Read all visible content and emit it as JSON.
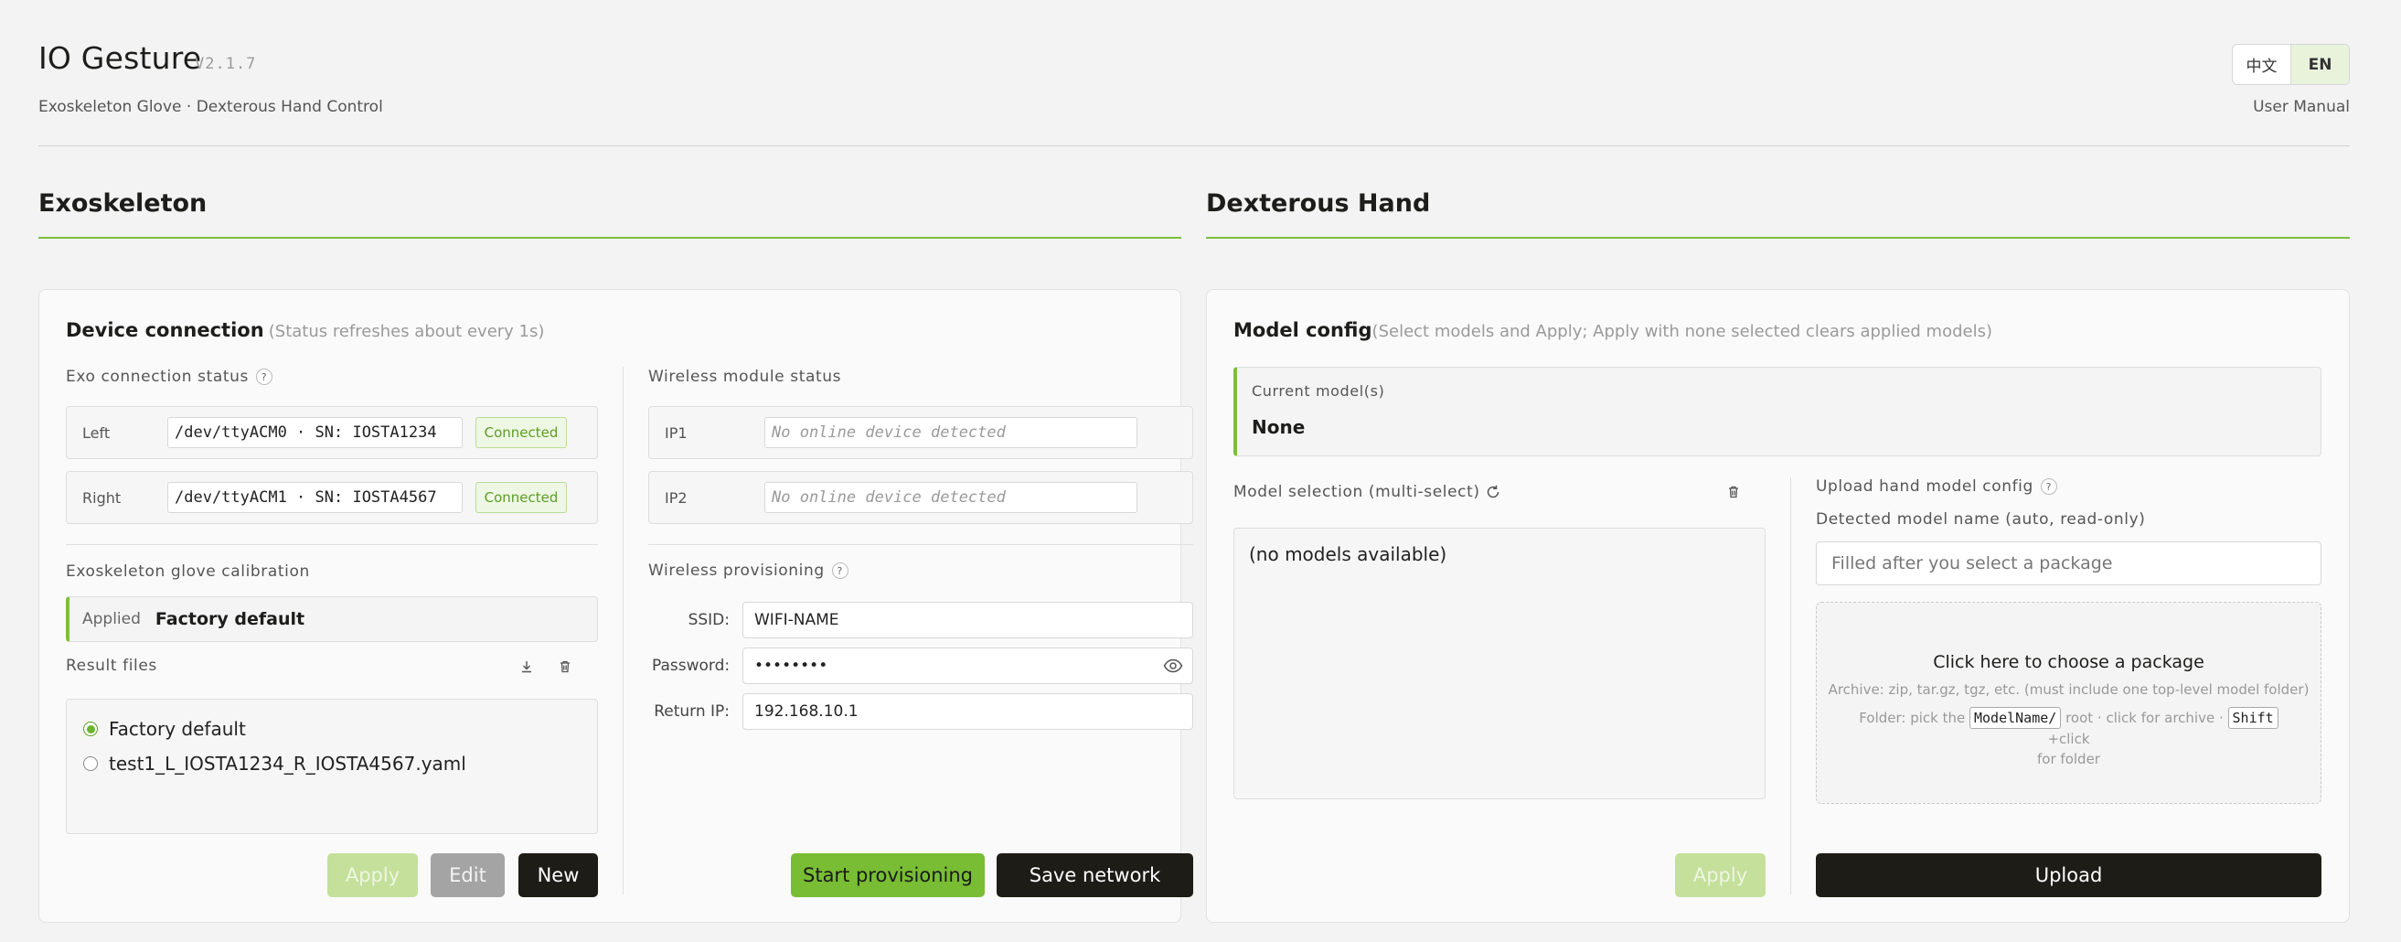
{
  "header": {
    "title": "IO Gesture",
    "version": "V2.1.7",
    "subtitle": "Exoskeleton Glove · Dexterous Hand Control",
    "lang_zh": "中文",
    "lang_en": "EN",
    "user_manual": "User Manual"
  },
  "sections": {
    "left_title": "Exoskeleton",
    "right_title": "Dexterous Hand"
  },
  "device_connection": {
    "title": "Device connection",
    "hint": "(Status refreshes about every 1s)",
    "exo_status_label": "Exo connection status",
    "rows": [
      {
        "label": "Left",
        "value": "/dev/ttyACM0 · SN: IOSTA1234",
        "status": "Connected"
      },
      {
        "label": "Right",
        "value": "/dev/ttyACM1 · SN: IOSTA4567",
        "status": "Connected"
      }
    ],
    "calibration_label": "Exoskeleton glove calibration",
    "applied_label": "Applied",
    "applied_value": "Factory default",
    "result_files_label": "Result files",
    "files": [
      {
        "name": "Factory default",
        "selected": true
      },
      {
        "name": "test1_L_IOSTA1234_R_IOSTA4567.yaml",
        "selected": false
      }
    ],
    "apply_label": "Apply",
    "edit_label": "Edit",
    "new_label": "New",
    "wireless_status_label": "Wireless module status",
    "ip_rows": [
      {
        "label": "IP1",
        "value": "No online device detected"
      },
      {
        "label": "IP2",
        "value": "No online device detected"
      }
    ],
    "provisioning_label": "Wireless provisioning",
    "ssid_label": "SSID:",
    "ssid_value": "WIFI-NAME",
    "password_label": "Password:",
    "password_value": "••••••••",
    "return_ip_label": "Return IP:",
    "return_ip_value": "192.168.10.1",
    "start_provisioning_label": "Start provisioning",
    "save_network_label": "Save network"
  },
  "model_config": {
    "title": "Model config",
    "hint": "(Select models and Apply; Apply with none selected clears applied models)",
    "current_label": "Current model(s)",
    "current_value": "None",
    "selection_label": "Model selection (multi-select)",
    "empty_list": "(no models available)",
    "apply_label": "Apply",
    "upload_label": "Upload hand model config",
    "detected_label": "Detected model name (auto, read-only)",
    "detected_placeholder": "Filled after you select a package",
    "dropzone_title": "Click here to choose a package",
    "dropzone_line1": "Archive: zip, tar.gz, tgz, etc. (must include one top-level model folder)",
    "dropzone_folder_prefix": "Folder: pick the",
    "dropzone_folder_kbd": "ModelName/",
    "dropzone_folder_mid": "root · click for archive ·",
    "dropzone_shift_kbd": "Shift",
    "dropzone_folder_suffix": "+click",
    "dropzone_folder_line2": "for folder",
    "upload_button": "Upload"
  },
  "colors": {
    "accent": "#7cbf3c",
    "connected_badge": "#5d9d26",
    "dark_button": "#1e1c17",
    "background": "#f3f3f3"
  },
  "icons": [
    "help-icon",
    "download-icon",
    "trash-icon",
    "refresh-icon",
    "eye-icon"
  ]
}
